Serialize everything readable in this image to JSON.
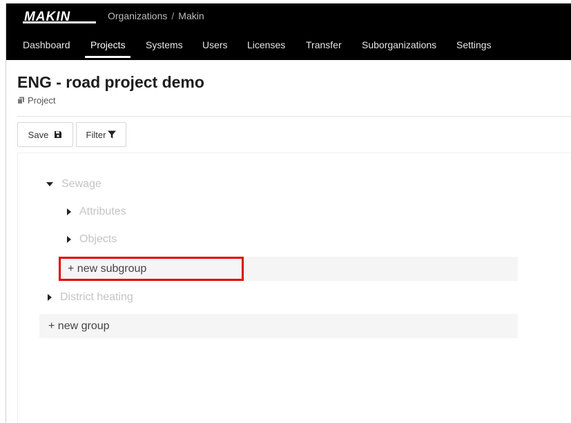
{
  "brand": {
    "logo_text": "MAKIN"
  },
  "breadcrumb": {
    "items": [
      "Organizations",
      "Makin"
    ],
    "separator": "/"
  },
  "nav": {
    "items": [
      "Dashboard",
      "Projects",
      "Systems",
      "Users",
      "Licenses",
      "Transfer",
      "Suborganizations",
      "Settings"
    ],
    "active": "Projects"
  },
  "page": {
    "title": "ENG - road project demo",
    "subtitle": "Project",
    "subtitle_icon": "copy-icon"
  },
  "toolbar": {
    "save_label": "Save",
    "save_icon": "floppy-disk-icon",
    "filter_label": "Filter",
    "filter_icon": "funnel-icon"
  },
  "tree": {
    "groups": [
      {
        "label": "Sewage",
        "expanded": true,
        "children": [
          "Attributes",
          "Objects"
        ],
        "new_subgroup_label": "+ new subgroup"
      },
      {
        "label": "District heating",
        "expanded": false
      }
    ],
    "new_group_label": "+ new group"
  },
  "colors": {
    "topbar": "#000000",
    "highlight": "#e00000",
    "muted_text": "#c4c4c4",
    "row_bg": "#f5f5f5"
  }
}
